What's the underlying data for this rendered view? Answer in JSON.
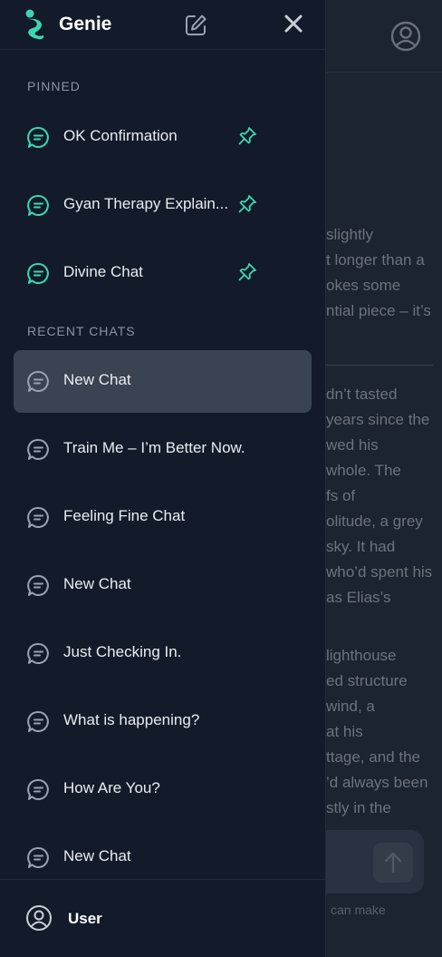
{
  "background": {
    "lines_block1": [
      "slightly",
      "t longer than a",
      "okes some",
      "ntial piece – it’s"
    ],
    "lines_block2": [
      "dn’t tasted",
      "years since the",
      "wed his",
      "whole. The",
      "fs of",
      "olitude, a grey",
      "sky. It had",
      "who’d spent his",
      "as Elias’s"
    ],
    "lines_block3": [
      "lighthouse",
      "ed structure",
      "wind, a",
      "at his",
      "ttage, and the",
      "’d always been",
      "stly in the"
    ],
    "disclaimer": "can make"
  },
  "sidebar": {
    "brand": "Genie",
    "pinned_label": "PINNED",
    "pinned": [
      {
        "label": "OK Confirmation"
      },
      {
        "label": "Gyan Therapy Explain..."
      },
      {
        "label": "Divine Chat"
      }
    ],
    "recent_label": "RECENT CHATS",
    "recent": [
      {
        "label": "New Chat"
      },
      {
        "label": "Train Me – I’m Better Now."
      },
      {
        "label": "Feeling Fine Chat"
      },
      {
        "label": "New Chat"
      },
      {
        "label": "Just Checking In."
      },
      {
        "label": "What is happening?"
      },
      {
        "label": "How Are You?"
      },
      {
        "label": "New Chat"
      }
    ],
    "user": "User"
  },
  "colors": {
    "accent": "#3dd6b5",
    "sidebar_bg": "#131b2b",
    "active_item": "#3a4352"
  }
}
